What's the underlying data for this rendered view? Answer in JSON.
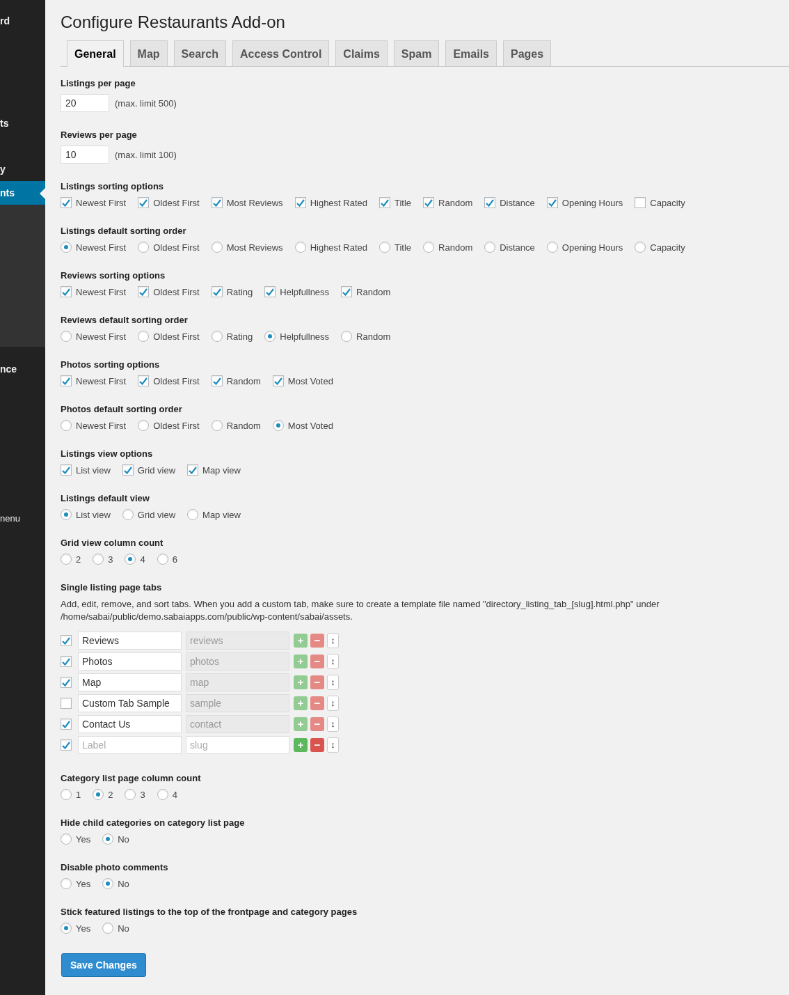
{
  "sidebar": {
    "items": [
      {
        "label": "rd",
        "selected": false
      },
      {
        "label": "ts",
        "selected": false
      },
      {
        "label": "y",
        "selected": false
      },
      {
        "label": "nts",
        "selected": true
      },
      {
        "label": "nce",
        "selected": false
      },
      {
        "label": "nenu",
        "selected": false
      }
    ]
  },
  "title": "Configure Restaurants Add-on",
  "tabs": [
    {
      "label": "General",
      "selected": true
    },
    {
      "label": "Map",
      "selected": false
    },
    {
      "label": "Search",
      "selected": false
    },
    {
      "label": "Access Control",
      "selected": false
    },
    {
      "label": "Claims",
      "selected": false
    },
    {
      "label": "Spam",
      "selected": false
    },
    {
      "label": "Emails",
      "selected": false
    },
    {
      "label": "Pages",
      "selected": false
    }
  ],
  "sections": [
    {
      "kind": "number",
      "label": "Listings per page",
      "value": "20",
      "note": "(max. limit 500)"
    },
    {
      "kind": "number",
      "label": "Reviews per page",
      "value": "10",
      "note": "(max. limit 100)"
    },
    {
      "kind": "checkbox",
      "label": "Listings sorting options",
      "options": [
        {
          "label": "Newest First",
          "checked": true
        },
        {
          "label": "Oldest First",
          "checked": true
        },
        {
          "label": "Most Reviews",
          "checked": true
        },
        {
          "label": "Highest Rated",
          "checked": true
        },
        {
          "label": "Title",
          "checked": true
        },
        {
          "label": "Random",
          "checked": true
        },
        {
          "label": "Distance",
          "checked": true
        },
        {
          "label": "Opening Hours",
          "checked": true
        },
        {
          "label": "Capacity",
          "checked": false
        }
      ]
    },
    {
      "kind": "radio",
      "label": "Listings default sorting order",
      "options": [
        {
          "label": "Newest First",
          "selected": true
        },
        {
          "label": "Oldest First",
          "selected": false
        },
        {
          "label": "Most Reviews",
          "selected": false
        },
        {
          "label": "Highest Rated",
          "selected": false
        },
        {
          "label": "Title",
          "selected": false
        },
        {
          "label": "Random",
          "selected": false
        },
        {
          "label": "Distance",
          "selected": false
        },
        {
          "label": "Opening Hours",
          "selected": false
        },
        {
          "label": "Capacity",
          "selected": false
        }
      ]
    },
    {
      "kind": "checkbox",
      "label": "Reviews sorting options",
      "options": [
        {
          "label": "Newest First",
          "checked": true
        },
        {
          "label": "Oldest First",
          "checked": true
        },
        {
          "label": "Rating",
          "checked": true
        },
        {
          "label": "Helpfullness",
          "checked": true
        },
        {
          "label": "Random",
          "checked": true
        }
      ]
    },
    {
      "kind": "radio",
      "label": "Reviews default sorting order",
      "options": [
        {
          "label": "Newest First",
          "selected": false
        },
        {
          "label": "Oldest First",
          "selected": false
        },
        {
          "label": "Rating",
          "selected": false
        },
        {
          "label": "Helpfullness",
          "selected": true
        },
        {
          "label": "Random",
          "selected": false
        }
      ]
    },
    {
      "kind": "checkbox",
      "label": "Photos sorting options",
      "options": [
        {
          "label": "Newest First",
          "checked": true
        },
        {
          "label": "Oldest First",
          "checked": true
        },
        {
          "label": "Random",
          "checked": true
        },
        {
          "label": "Most Voted",
          "checked": true
        }
      ]
    },
    {
      "kind": "radio",
      "label": "Photos default sorting order",
      "options": [
        {
          "label": "Newest First",
          "selected": false
        },
        {
          "label": "Oldest First",
          "selected": false
        },
        {
          "label": "Random",
          "selected": false
        },
        {
          "label": "Most Voted",
          "selected": true
        }
      ]
    },
    {
      "kind": "checkbox",
      "label": "Listings view options",
      "options": [
        {
          "label": "List view",
          "checked": true
        },
        {
          "label": "Grid view",
          "checked": true
        },
        {
          "label": "Map view",
          "checked": true
        }
      ]
    },
    {
      "kind": "radio",
      "label": "Listings default view",
      "options": [
        {
          "label": "List view",
          "selected": true
        },
        {
          "label": "Grid view",
          "selected": false
        },
        {
          "label": "Map view",
          "selected": false
        }
      ]
    },
    {
      "kind": "radio",
      "label": "Grid view column count",
      "options": [
        {
          "label": "2",
          "selected": false
        },
        {
          "label": "3",
          "selected": false
        },
        {
          "label": "4",
          "selected": true
        },
        {
          "label": "6",
          "selected": false
        }
      ]
    },
    {
      "kind": "tabs",
      "label": "Single listing page tabs",
      "description": "Add, edit, remove, and sort tabs. When you add a custom tab, make sure to create a template file named \"directory_listing_tab_[slug].html.php\" under /home/sabai/public/demo.sabaiapps.com/public/wp-content/sabai/assets.",
      "rows": [
        {
          "checked": true,
          "label": "Reviews",
          "slug": "reviews",
          "disabled": true
        },
        {
          "checked": true,
          "label": "Photos",
          "slug": "photos",
          "disabled": true
        },
        {
          "checked": true,
          "label": "Map",
          "slug": "map",
          "disabled": true
        },
        {
          "checked": false,
          "label": "Custom Tab Sample",
          "slug": "sample",
          "disabled": true
        },
        {
          "checked": true,
          "label": "Contact Us",
          "slug": "contact",
          "disabled": true
        },
        {
          "checked": true,
          "label_placeholder": "Label",
          "slug_placeholder": "slug",
          "disabled": false
        }
      ],
      "buttons": {
        "add": "+",
        "remove": "−",
        "sort": "↕"
      }
    },
    {
      "kind": "radio",
      "label": "Category list page column count",
      "options": [
        {
          "label": "1",
          "selected": false
        },
        {
          "label": "2",
          "selected": true
        },
        {
          "label": "3",
          "selected": false
        },
        {
          "label": "4",
          "selected": false
        }
      ]
    },
    {
      "kind": "radio",
      "label": "Hide child categories on category list page",
      "options": [
        {
          "label": "Yes",
          "selected": false
        },
        {
          "label": "No",
          "selected": true
        }
      ]
    },
    {
      "kind": "radio",
      "label": "Disable photo comments",
      "options": [
        {
          "label": "Yes",
          "selected": false
        },
        {
          "label": "No",
          "selected": true
        }
      ]
    },
    {
      "kind": "radio",
      "label": "Stick featured listings to the top of the frontpage and category pages",
      "options": [
        {
          "label": "Yes",
          "selected": true
        },
        {
          "label": "No",
          "selected": false
        }
      ]
    }
  ],
  "save_button": "Save Changes"
}
